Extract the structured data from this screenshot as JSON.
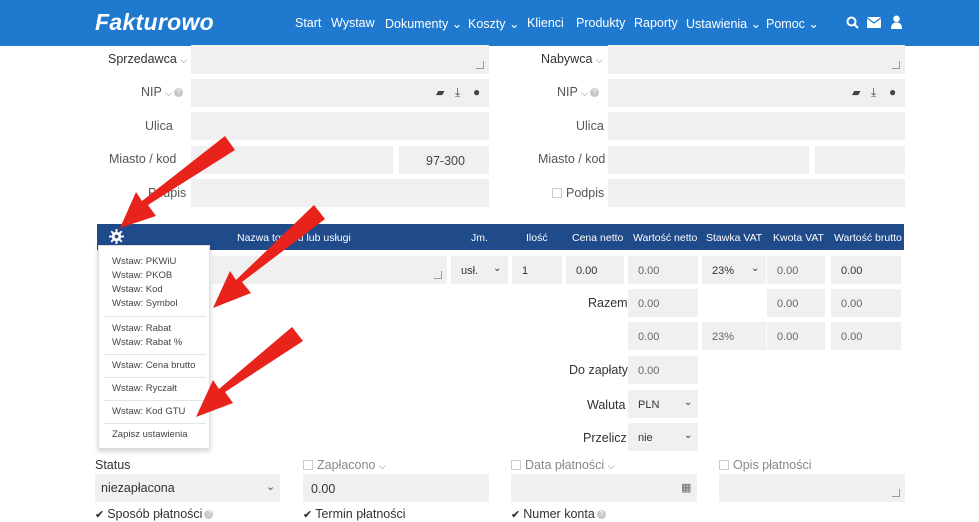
{
  "nav": {
    "logo": "Fakturowo",
    "items": [
      "Start",
      "Wystaw",
      "Dokumenty",
      "Koszty",
      "Klienci",
      "Produkty",
      "Raporty",
      "Ustawienia",
      "Pomoc"
    ],
    "dropdown_flags": [
      false,
      false,
      true,
      true,
      false,
      false,
      false,
      true,
      true
    ]
  },
  "seller": {
    "title": "Sprzedawca",
    "nip_label": "NIP",
    "ulica_label": "Ulica",
    "miasto_label": "Miasto / kod",
    "kod_value": "97-300",
    "podpis_label": "Podpis"
  },
  "buyer": {
    "title": "Nabywca",
    "nip_label": "NIP",
    "ulica_label": "Ulica",
    "miasto_label": "Miasto / kod",
    "podpis_label": "Podpis"
  },
  "table": {
    "headers": {
      "name": "Nazwa towaru lub usługi",
      "jm": "Jm.",
      "ilosc": "Ilość",
      "cena_netto": "Cena netto",
      "wartosc_netto": "Wartość netto",
      "stawka_vat": "Stawka VAT",
      "kwota_vat": "Kwota VAT",
      "wartosc_brutto": "Wartość brutto"
    },
    "row": {
      "jm": "usł.",
      "ilosc": "1",
      "cena_netto": "0.00",
      "wartosc_netto": "0.00",
      "stawka_vat": "23%",
      "kwota_vat": "0.00",
      "wartosc_brutto": "0.00"
    }
  },
  "settings_menu": {
    "items": [
      "Wstaw: PKWiU",
      "Wstaw: PKOB",
      "Wstaw: Kod",
      "Wstaw: Symbol",
      "Wstaw: Rabat",
      "Wstaw: Rabat %",
      "Wstaw: Cena brutto",
      "Wstaw: Ryczałt",
      "Wstaw: Kod GTU",
      "Zapisz ustawienia"
    ]
  },
  "summary": {
    "razem_label": "Razem",
    "razem_netto": "0.00",
    "razem_vat": "0.00",
    "razem_brutto": "0.00",
    "vat_row_netto": "0.00",
    "vat_row_rate": "23%",
    "vat_row_vat": "0.00",
    "vat_row_brutto": "0.00",
    "do_zaplaty_label": "Do zapłaty",
    "do_zaplaty_value": "0.00",
    "waluta_label": "Waluta",
    "waluta_value": "PLN",
    "przelicz_label": "Przelicz",
    "przelicz_value": "nie"
  },
  "bottom": {
    "status_label": "Status",
    "status_value": "niezapłacona",
    "zaplacono_label": "Zapłacono",
    "zaplacono_value": "0.00",
    "data_platnosci_label": "Data płatności",
    "opis_platnosci_label": "Opis płatności",
    "sposob_label": "Sposób płatności",
    "termin_label": "Termin płatności",
    "numer_konta_label": "Numer konta"
  },
  "colors": {
    "nav": "#1e79cf",
    "table_header": "#1f4b8a",
    "arrow": "#e8231c",
    "field": "#f0f0f0"
  }
}
